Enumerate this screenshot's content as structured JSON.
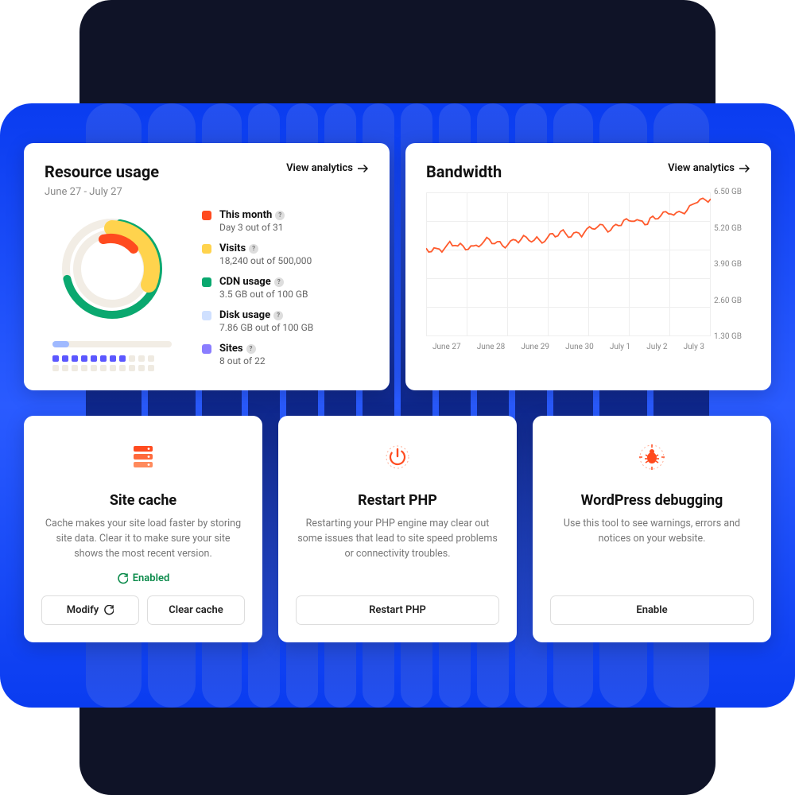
{
  "resource": {
    "title": "Resource usage",
    "date_range": "June 27 - July 27",
    "view_link": "View analytics",
    "legend": [
      {
        "color": "#ff4b1f",
        "label": "This month",
        "sub": "Day 3 out of 31"
      },
      {
        "color": "#ffd34d",
        "label": "Visits",
        "sub": "18,240 out of 500,000"
      },
      {
        "color": "#0aa86f",
        "label": "CDN usage",
        "sub": "3.5 GB out of 100 GB"
      },
      {
        "color": "#cfe0ff",
        "label": "Disk usage",
        "sub": "7.86 GB out of 100 GB"
      },
      {
        "color": "#8a7dff",
        "label": "Sites",
        "sub": "8 out of 22"
      }
    ],
    "sites_on": 8,
    "sites_total": 22,
    "disk_pct": 8
  },
  "bandwidth": {
    "title": "Bandwidth",
    "view_link": "View analytics"
  },
  "chart_data": {
    "type": "line",
    "title": "Bandwidth",
    "ylabel": "GB",
    "ylim": [
      0,
      6.5
    ],
    "y_ticks": [
      "6.50 GB",
      "5.20 GB",
      "3.90 GB",
      "2.60 GB",
      "1.30 GB"
    ],
    "x_ticks": [
      "June 27",
      "June 28",
      "June 29",
      "June 30",
      "July 1",
      "July 2",
      "July 3"
    ],
    "categories": [
      "June 27",
      "June 28",
      "June 29",
      "June 30",
      "July 1",
      "July 2",
      "July 3"
    ],
    "values": [
      3.9,
      4.1,
      4.3,
      4.6,
      5.0,
      5.4,
      6.2
    ]
  },
  "tools": {
    "cache": {
      "title": "Site cache",
      "desc": "Cache makes your site load faster by storing site data. Clear it to make sure your site shows the most recent version.",
      "status": "Enabled",
      "modify_btn": "Modify",
      "clear_btn": "Clear cache"
    },
    "php": {
      "title": "Restart PHP",
      "desc": "Restarting your PHP engine may clear out some issues that lead to site speed problems or connectivity troubles.",
      "btn": "Restart PHP"
    },
    "debug": {
      "title": "WordPress debugging",
      "desc": "Use this tool to see warnings, errors and notices on your website.",
      "btn": "Enable"
    }
  }
}
